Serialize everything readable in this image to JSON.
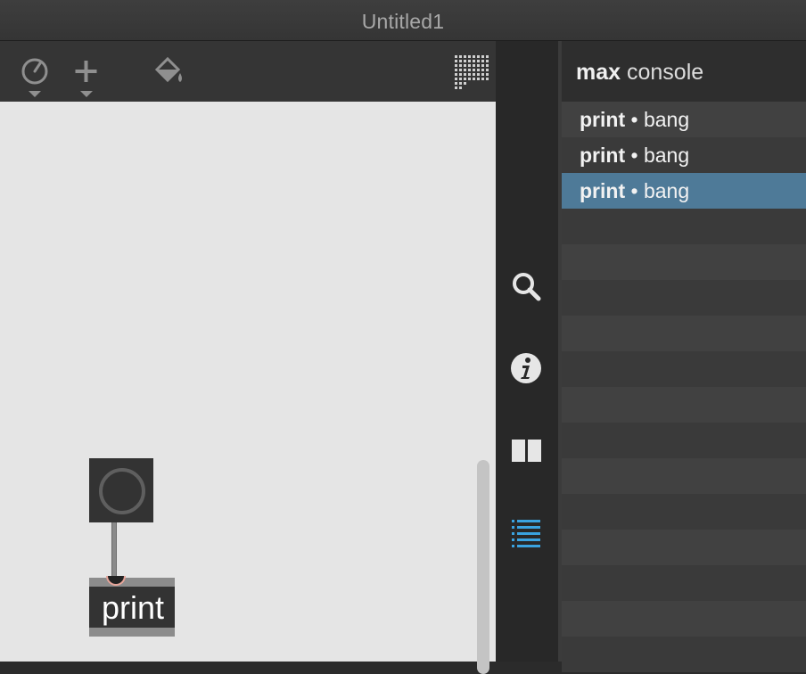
{
  "window": {
    "title": "Untitled1"
  },
  "toolbar": {
    "icons": [
      "presentation-dial-icon",
      "add-object-icon",
      "paint-bucket-icon",
      "grid-icon"
    ]
  },
  "patcher": {
    "objects": [
      {
        "type": "button",
        "icon": "bang-circle-icon"
      },
      {
        "type": "object",
        "label": "print"
      }
    ]
  },
  "sidebar": {
    "icons": [
      "search-icon",
      "info-icon",
      "split-view-icon",
      "console-list-icon"
    ],
    "active": "console-list-icon",
    "active_color": "#3aa3e0"
  },
  "console": {
    "title_bold": "max",
    "title_rest": " console",
    "messages": [
      {
        "source": "print",
        "separator": " • ",
        "text": "bang",
        "selected": false
      },
      {
        "source": "print",
        "separator": " • ",
        "text": "bang",
        "selected": false
      },
      {
        "source": "print",
        "separator": " • ",
        "text": "bang",
        "selected": true
      }
    ],
    "selection_color": "#4e7a98"
  }
}
